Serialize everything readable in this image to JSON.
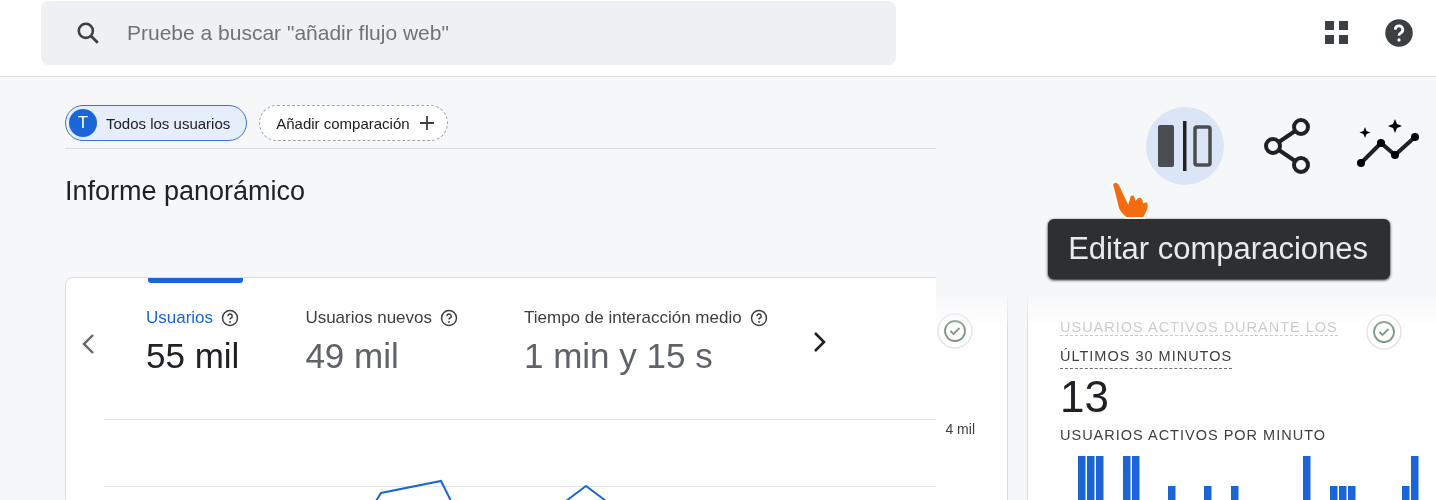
{
  "search": {
    "placeholder": "Pruebe a buscar \"añadir flujo web\""
  },
  "comparisons": [
    {
      "kind": "segment",
      "avatar": "T",
      "label": "Todos los usuarios",
      "selected": true
    },
    {
      "kind": "add",
      "label": "Añadir comparación",
      "selected": false
    }
  ],
  "page_title": "Informe panorámico",
  "toolbar": {
    "tooltip": "Editar comparaciones",
    "actions": [
      {
        "kind": "compare",
        "selected": true
      },
      {
        "kind": "share",
        "selected": false
      },
      {
        "kind": "insights",
        "selected": false
      }
    ]
  },
  "metrics": [
    {
      "label": "Usuarios",
      "value": "55 mil",
      "selected": true
    },
    {
      "label": "Usuarios nuevos",
      "value": "49 mil",
      "selected": false
    },
    {
      "label": "Tiempo de interacción medio",
      "value": "1 min y 15 s",
      "selected": false
    }
  ],
  "chart_ticks": [
    "4 mil"
  ],
  "realtime": {
    "title_faded": "USUARIOS ACTIVOS DURANTE LOS",
    "title": "ÚLTIMOS 30 MINUTOS",
    "value": "13",
    "subtitle": "USUARIOS ACTIVOS POR MINUTO"
  }
}
